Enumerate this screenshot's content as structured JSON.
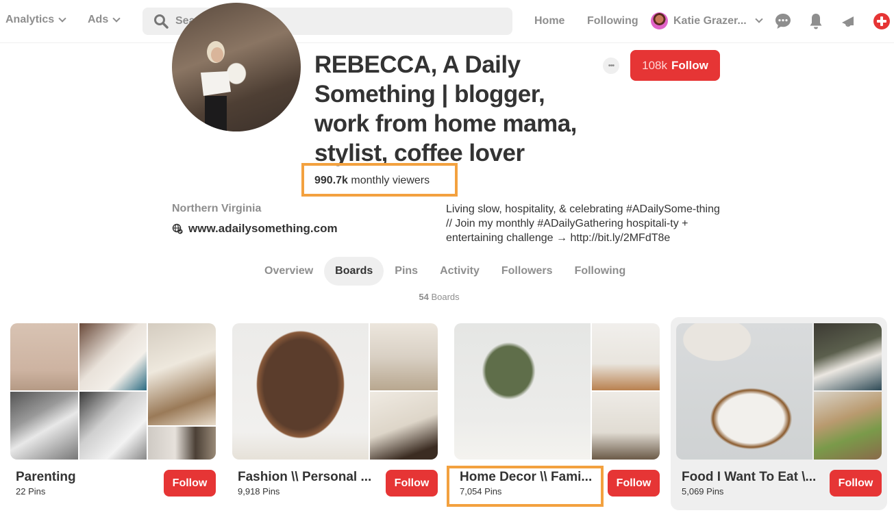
{
  "topbar": {
    "analytics_label": "Analytics",
    "ads_label": "Ads",
    "search_placeholder": "Search",
    "home_label": "Home",
    "following_label": "Following",
    "user_name": "Katie Grazer...",
    "icons": [
      "chat-icon",
      "bell-icon",
      "megaphone-icon",
      "add-icon"
    ]
  },
  "profile": {
    "name": "REBECCA, A Daily Something | blogger, work from home mama, stylist, coffee lover",
    "monthly_viewers_value": "990.7k",
    "monthly_viewers_label": "monthly viewers",
    "follower_count": "108k",
    "follow_label": "Follow",
    "more_label": "•••",
    "location": "Northern Virginia",
    "website": "www.adailysomething.com",
    "bio": "Living slow, hospitality, & celebrating #ADailySome-thing // Join my monthly #ADailyGathering hospitali-ty + entertaining challenge → http://bit.ly/2MFdT8e"
  },
  "tabs": [
    {
      "label": "Overview",
      "active": false
    },
    {
      "label": "Boards",
      "active": true
    },
    {
      "label": "Pins",
      "active": false
    },
    {
      "label": "Activity",
      "active": false
    },
    {
      "label": "Followers",
      "active": false
    },
    {
      "label": "Following",
      "active": false
    }
  ],
  "board_count": {
    "value": "54",
    "label": "Boards"
  },
  "boards": [
    {
      "name": "Parenting",
      "pins": "22 Pins",
      "follow_label": "Follow"
    },
    {
      "name": "Fashion \\\\ Personal ...",
      "pins": "9,918 Pins",
      "follow_label": "Follow"
    },
    {
      "name": "Home Decor \\\\ Fami...",
      "pins": "7,054 Pins",
      "follow_label": "Follow"
    },
    {
      "name": "Food I Want To Eat \\...",
      "pins": "5,069 Pins",
      "follow_label": "Follow"
    }
  ],
  "colors": {
    "accent_red": "#e63535",
    "highlight_orange": "#f3a13f",
    "muted_gray": "#8e8e8e"
  }
}
